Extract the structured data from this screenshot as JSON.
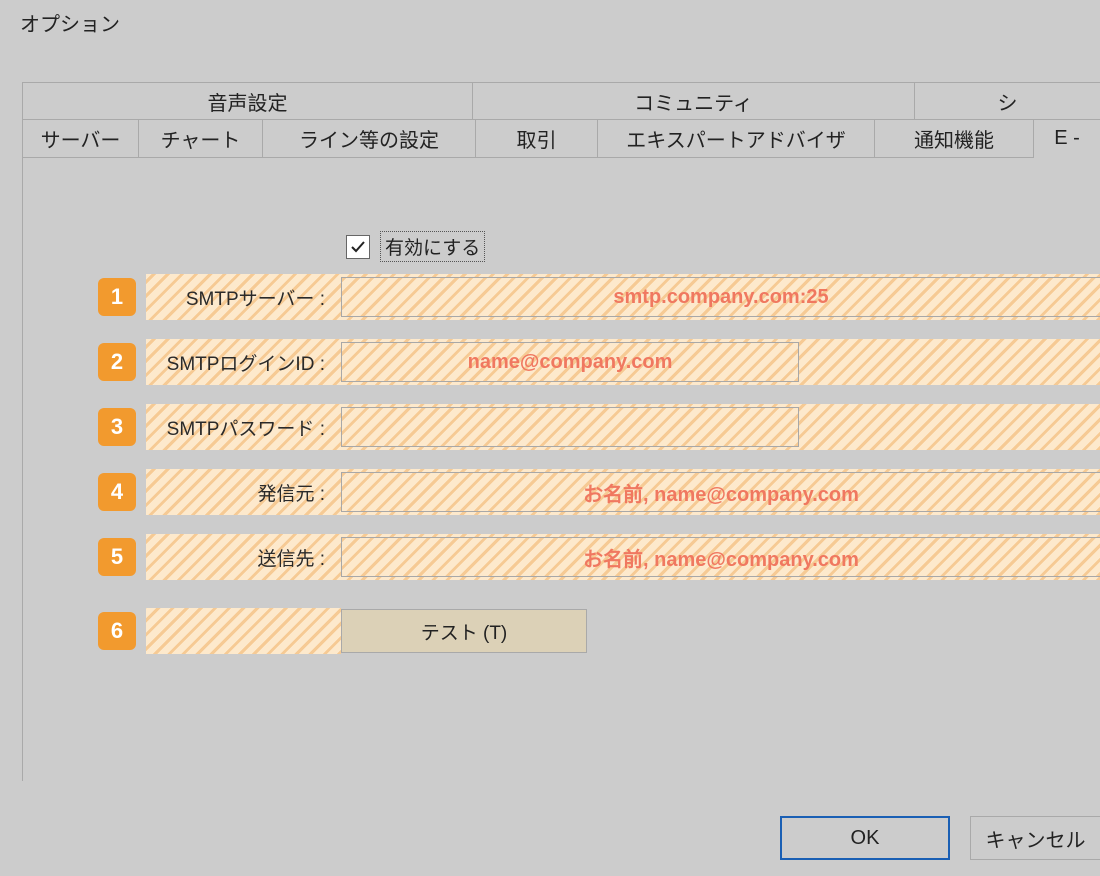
{
  "title": "オプション",
  "tabs_top": [
    {
      "label": "音声設定"
    },
    {
      "label": "コミュニティ"
    },
    {
      "label": "シ"
    }
  ],
  "tabs_bottom": [
    {
      "label": "サーバー"
    },
    {
      "label": "チャート"
    },
    {
      "label": "ライン等の設定"
    },
    {
      "label": "取引"
    },
    {
      "label": "エキスパートアドバイザ"
    },
    {
      "label": "通知機能"
    },
    {
      "label": "E -"
    }
  ],
  "enable": {
    "checked": true,
    "label": "有効にする"
  },
  "rows": [
    {
      "num": "1",
      "label": "SMTPサーバー :",
      "value": "smtp.company.com:25"
    },
    {
      "num": "2",
      "label": "SMTPログインID :",
      "value": "name@company.com"
    },
    {
      "num": "3",
      "label": "SMTPパスワード :",
      "value": ""
    },
    {
      "num": "4",
      "label": "発信元 :",
      "value": "お名前, name@company.com"
    },
    {
      "num": "5",
      "label": "送信先 :",
      "value": "お名前, name@company.com"
    },
    {
      "num": "6",
      "label": "",
      "button": "テスト (T)"
    }
  ],
  "buttons": {
    "ok": "OK",
    "cancel": "キャンセル"
  }
}
